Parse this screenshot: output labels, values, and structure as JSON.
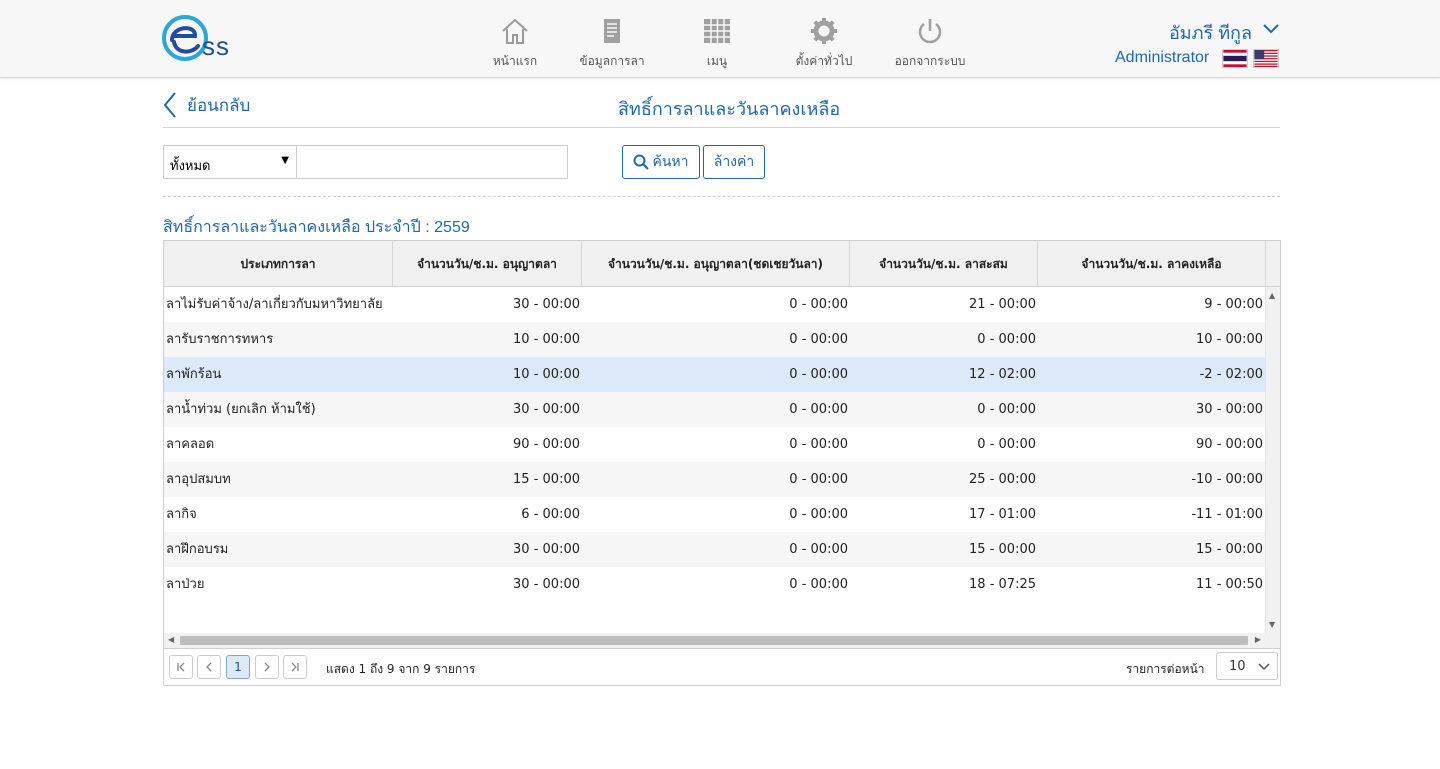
{
  "header": {
    "logo_text": "ss",
    "nav": [
      {
        "label": "หน้าแรก",
        "icon": "home-icon"
      },
      {
        "label": "ข้อมูลการลา",
        "icon": "document-icon"
      },
      {
        "label": "เมนู",
        "icon": "grid-menu-icon"
      },
      {
        "label": "ตั้งค่าทั่วไป",
        "icon": "gear-icon"
      },
      {
        "label": "ออกจากระบบ",
        "icon": "power-icon"
      }
    ],
    "user_name": "อัมภรี ทีกูล",
    "user_role": "Administrator"
  },
  "titlebar": {
    "back_label": "ย้อนกลับ",
    "page_title": "สิทธิ์การลาและวันลาคงเหลือ"
  },
  "search": {
    "filter_value": "ทั้งหมด",
    "input_value": "",
    "input_placeholder": "",
    "search_label": "ค้นหา",
    "clear_label": "ล้างค่า"
  },
  "section_title": "สิทธิ์การลาและวันลาคงเหลือ ประจำปี : 2559",
  "table": {
    "columns": [
      "ประเภทการลา",
      "จำนวนวัน/ช.ม. อนุญาตลา",
      "จำนวนวัน/ช.ม. อนุญาตลา(ชดเชยวันลา)",
      "จำนวนวัน/ช.ม. ลาสะสม",
      "จำนวนวัน/ช.ม. ลาคงเหลือ"
    ],
    "rows": [
      [
        "ลาไม่รับค่าจ้าง/ลาเกี่ยวกับมหาวิทยาลัย",
        "30 - 00:00",
        "0 - 00:00",
        "21 - 00:00",
        "9 - 00:00"
      ],
      [
        "ลารับราชการทหาร",
        "10 - 00:00",
        "0 - 00:00",
        "0 - 00:00",
        "10 - 00:00"
      ],
      [
        "ลาพักร้อน",
        "10 - 00:00",
        "0 - 00:00",
        "12 - 02:00",
        "-2 - 02:00"
      ],
      [
        "ลาน้ำท่วม (ยกเลิก ห้ามใช้)",
        "30 - 00:00",
        "0 - 00:00",
        "0 - 00:00",
        "30 - 00:00"
      ],
      [
        "ลาคลอด",
        "90 - 00:00",
        "0 - 00:00",
        "0 - 00:00",
        "90 - 00:00"
      ],
      [
        "ลาอุปสมบท",
        "15 - 00:00",
        "0 - 00:00",
        "25 - 00:00",
        "-10 - 00:00"
      ],
      [
        "ลากิจ",
        "6 - 00:00",
        "0 - 00:00",
        "17 - 01:00",
        "-11 - 01:00"
      ],
      [
        "ลาฝึกอบรม",
        "30 - 00:00",
        "0 - 00:00",
        "15 - 00:00",
        "15 - 00:00"
      ],
      [
        "ลาป่วย",
        "30 - 00:00",
        "0 - 00:00",
        "18 - 07:25",
        "11 - 00:50"
      ]
    ],
    "selected_row_index": 2
  },
  "pager": {
    "current_page": "1",
    "info": "แสดง 1 ถึง 9 จาก 9 รายการ",
    "per_page_label": "รายการต่อหน้า",
    "per_page_value": "10"
  },
  "colors": {
    "accent": "#1f66b3",
    "selected_row": "#dbe9f9",
    "header_bg": "#f7f7f7"
  }
}
